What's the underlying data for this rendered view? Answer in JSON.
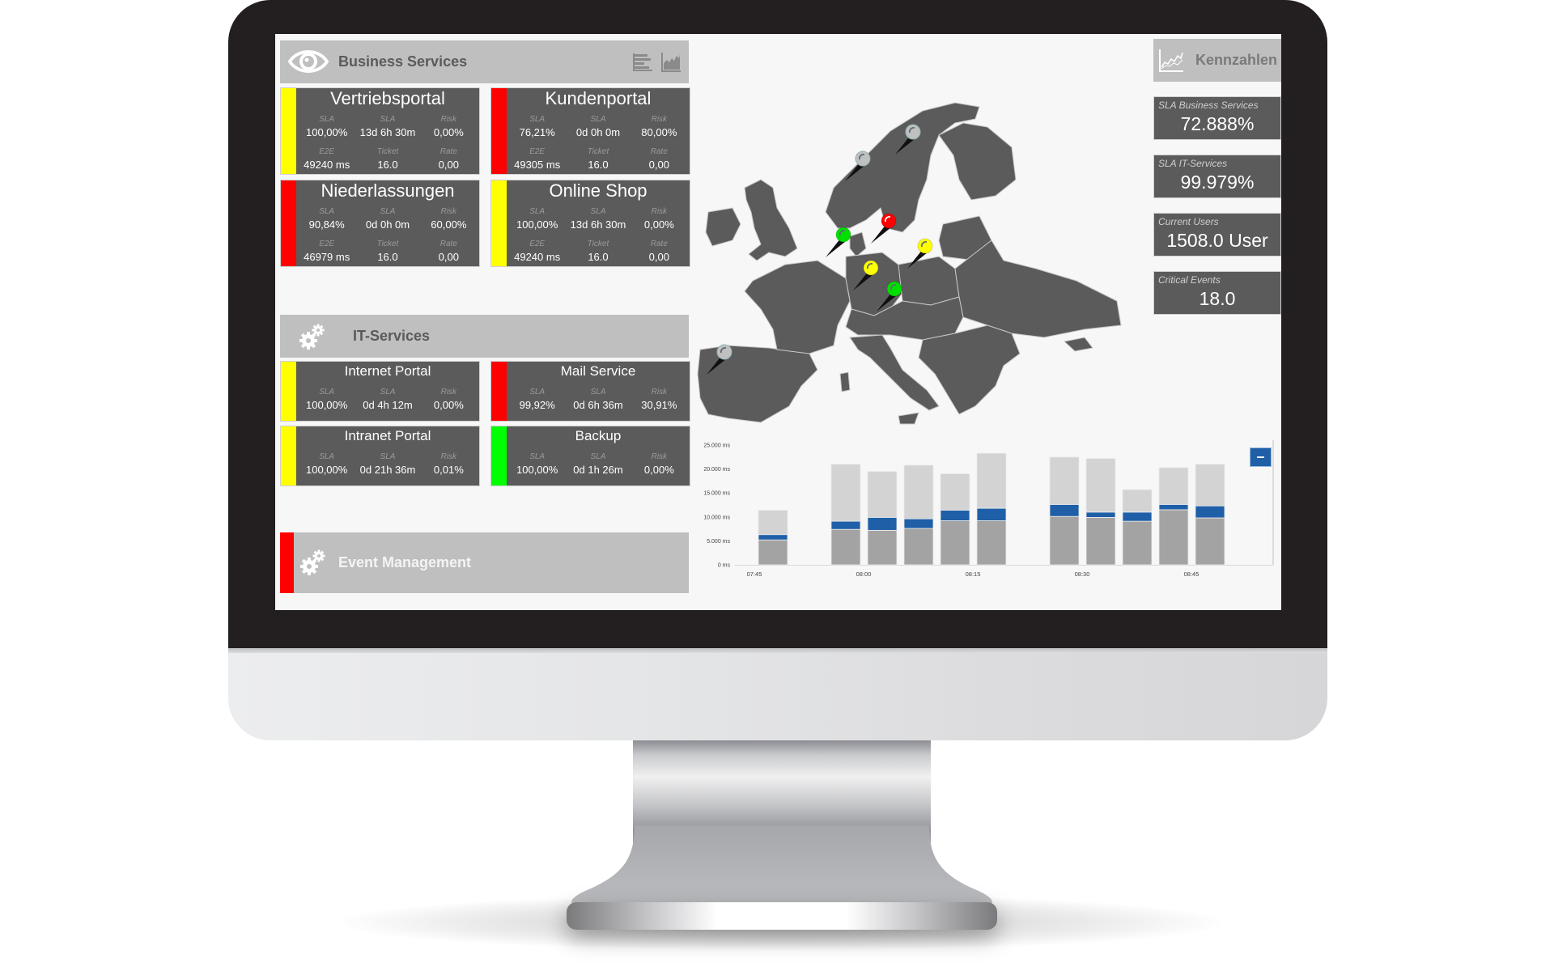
{
  "business_services": {
    "title": "Business Services",
    "header_icons": [
      "eye-icon",
      "bar-list-icon",
      "area-chart-icon"
    ],
    "cards": [
      {
        "name": "Vertriebsportal",
        "status_color": "#ffff00",
        "labels": [
          "SLA",
          "SLA",
          "Risk",
          "E2E",
          "Ticket",
          "Rate"
        ],
        "values": [
          "100,00%",
          "13d 6h 30m",
          "0,00%",
          "49240  ms",
          "16.0",
          "0,00"
        ]
      },
      {
        "name": "Kundenportal",
        "status_color": "#ff0000",
        "labels": [
          "SLA",
          "SLA",
          "Risk",
          "E2E",
          "Ticket",
          "Rate"
        ],
        "values": [
          "76,21%",
          "0d 0h 0m",
          "80,00%",
          "49305  ms",
          "16.0",
          "0,00"
        ]
      },
      {
        "name": "Niederlassungen",
        "status_color": "#ff0000",
        "labels": [
          "SLA",
          "SLA",
          "Risk",
          "E2E",
          "Ticket",
          "Rate"
        ],
        "values": [
          "90,84%",
          "0d 0h 0m",
          "60,00%",
          "46979  ms",
          "16.0",
          "0,00"
        ]
      },
      {
        "name": "Online Shop",
        "status_color": "#ffff00",
        "labels": [
          "SLA",
          "SLA",
          "Risk",
          "E2E",
          "Ticket",
          "Rate"
        ],
        "values": [
          "100,00%",
          "13d 6h 30m",
          "0,00%",
          "49240  ms",
          "16.0",
          "0,00"
        ]
      }
    ]
  },
  "it_services": {
    "title": "IT-Services",
    "icon": "gears-icon",
    "cards": [
      {
        "name": "Internet Portal",
        "status_color": "#ffff00",
        "labels": [
          "SLA",
          "SLA",
          "Risk"
        ],
        "values": [
          "100,00%",
          "0d 4h 12m",
          "0,00%"
        ]
      },
      {
        "name": "Mail Service",
        "status_color": "#ff0000",
        "labels": [
          "SLA",
          "SLA",
          "Risk"
        ],
        "values": [
          "99,92%",
          "0d 6h 36m",
          "30,91%"
        ]
      },
      {
        "name": "Intranet Portal",
        "status_color": "#ffff00",
        "labels": [
          "SLA",
          "SLA",
          "Risk"
        ],
        "values": [
          "100,00%",
          "0d 21h 36m",
          "0,01%"
        ]
      },
      {
        "name": "Backup",
        "status_color": "#00ff00",
        "labels": [
          "SLA",
          "SLA",
          "Risk"
        ],
        "values": [
          "100,00%",
          "0d 1h 26m",
          "0,00%"
        ]
      }
    ]
  },
  "event_management": {
    "title": "Event Management",
    "status_color": "#ff0000",
    "icon": "gears-icon"
  },
  "kennzahlen": {
    "title": "Kennzahlen",
    "icon": "area-chart-icon",
    "tiles": [
      {
        "label": "SLA Business Services",
        "value": "72.888%"
      },
      {
        "label": "SLA IT-Services",
        "value": "99.979%"
      },
      {
        "label": "Current Users",
        "value": "1508.0 User"
      },
      {
        "label": "Critical Events",
        "value": "18.0"
      }
    ]
  },
  "map": {
    "region": "Europe",
    "pins": [
      {
        "location": "Norway",
        "status": "inactive",
        "color": "#c0c0c0"
      },
      {
        "location": "Sweden",
        "status": "inactive",
        "color": "#c0c0c0"
      },
      {
        "location": "Netherlands",
        "status": "ok",
        "color": "#00e000"
      },
      {
        "location": "Northern Germany",
        "status": "critical",
        "color": "#ff0000"
      },
      {
        "location": "Czech Republic",
        "status": "warning",
        "color": "#ffff00"
      },
      {
        "location": "Southern Germany",
        "status": "warning",
        "color": "#ffff00"
      },
      {
        "location": "Northern Italy",
        "status": "ok",
        "color": "#00e000"
      },
      {
        "location": "Portugal",
        "status": "inactive",
        "color": "#c0c0c0"
      }
    ]
  },
  "colors": {
    "accent_blue": "#1f5fa8",
    "card_bg": "#5b5b5b",
    "header_bg": "#bfbfbf",
    "bar_light": "#d3d3d3",
    "bar_dark": "#a3a3a3"
  },
  "chart_controls": {
    "collapse_label": "–"
  },
  "chart_data": {
    "type": "bar",
    "stacked": true,
    "title": "",
    "xlabel": "",
    "ylabel": "",
    "ylim": [
      0,
      25000
    ],
    "y_unit": "ms",
    "y_ticks": [
      "0 ms",
      "5.000 ms",
      "10.000 ms",
      "15.000 ms",
      "20.000 ms",
      "25.000 ms"
    ],
    "y_tick_values": [
      0,
      5000,
      10000,
      15000,
      20000,
      25000
    ],
    "x_tick_labels": [
      "07:45",
      "08:00",
      "08:15",
      "08:30",
      "08:45"
    ],
    "x_tick_slots": [
      0,
      3,
      6,
      9,
      12
    ],
    "categories": [
      "07:45",
      "07:50",
      "07:55",
      "08:00",
      "08:05",
      "08:10",
      "08:15",
      "08:20",
      "08:25",
      "08:30",
      "08:35",
      "08:40",
      "08:45"
    ],
    "series": [
      {
        "name": "base",
        "color": "#a3a3a3",
        "values": [
          5200,
          null,
          7400,
          7200,
          7600,
          9200,
          9200,
          null,
          10100,
          9900,
          9100,
          11500,
          9800
        ]
      },
      {
        "name": "middle",
        "color": "#1f5fa8",
        "values": [
          1100,
          null,
          1700,
          2700,
          2000,
          2200,
          2600,
          null,
          2500,
          1100,
          1900,
          1100,
          2500
        ]
      },
      {
        "name": "top",
        "color": "#d3d3d3",
        "values": [
          5100,
          null,
          11900,
          9600,
          11200,
          7600,
          11500,
          null,
          9900,
          11200,
          4700,
          7700,
          8700
        ]
      }
    ],
    "legend": "none",
    "grid": false
  }
}
